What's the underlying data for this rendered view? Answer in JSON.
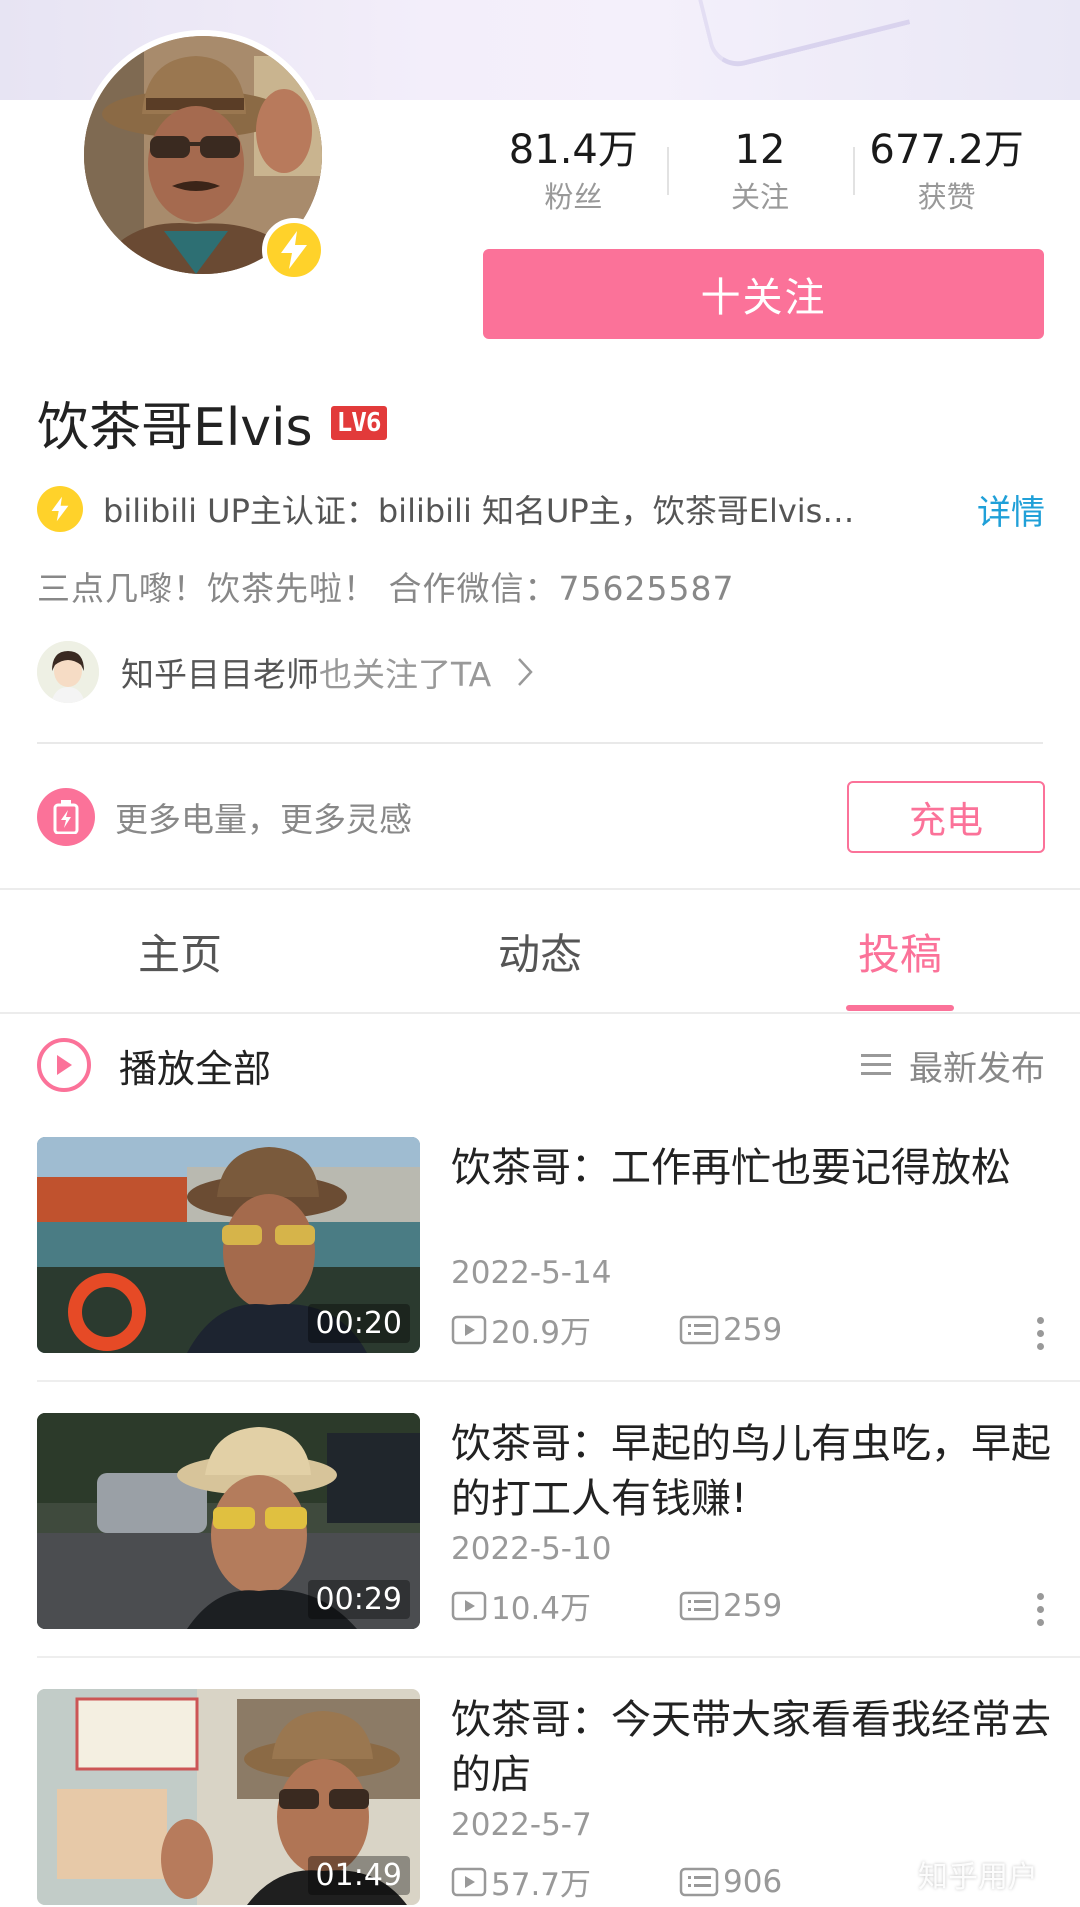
{
  "profile": {
    "name": "饮茶哥Elvis",
    "level_badge": "LV6",
    "stats": [
      {
        "value": "81.4万",
        "label": "粉丝"
      },
      {
        "value": "12",
        "label": "关注"
      },
      {
        "value": "677.2万",
        "label": "获赞"
      }
    ],
    "follow_label": "十关注",
    "certification": "bilibili UP主认证：bilibili 知名UP主，饮茶哥Elvis…",
    "certification_detail": "详情",
    "bio": "三点几嚟！饮茶先啦！ 合作微信：75625587",
    "mutual_name": "知乎目目老师",
    "mutual_suffix": "也关注了TA"
  },
  "charge": {
    "text": "更多电量，更多灵感",
    "button": "充电"
  },
  "tabs": [
    {
      "label": "主页",
      "active": false
    },
    {
      "label": "动态",
      "active": false
    },
    {
      "label": "投稿",
      "active": true
    }
  ],
  "list_header": {
    "play_all": "播放全部",
    "sort": "最新发布"
  },
  "videos": [
    {
      "title": "饮茶哥：工作再忙也要记得放松",
      "date": "2022-5-14",
      "duration": "00:20",
      "views": "20.9万",
      "comments": "259"
    },
    {
      "title": "饮茶哥：早起的鸟儿有虫吃，早起的打工人有钱赚!",
      "date": "2022-5-10",
      "duration": "00:29",
      "views": "10.4万",
      "comments": "259"
    },
    {
      "title": "饮茶哥：今天带大家看看我经常去的店",
      "date": "2022-5-7",
      "duration": "01:49",
      "views": "57.7万",
      "comments": "906"
    }
  ],
  "watermark": "知乎用户",
  "colors": {
    "accent": "#fb7299",
    "link": "#20a0d8",
    "badge_yellow": "#ffd22a",
    "level_red": "#e23a3a"
  }
}
